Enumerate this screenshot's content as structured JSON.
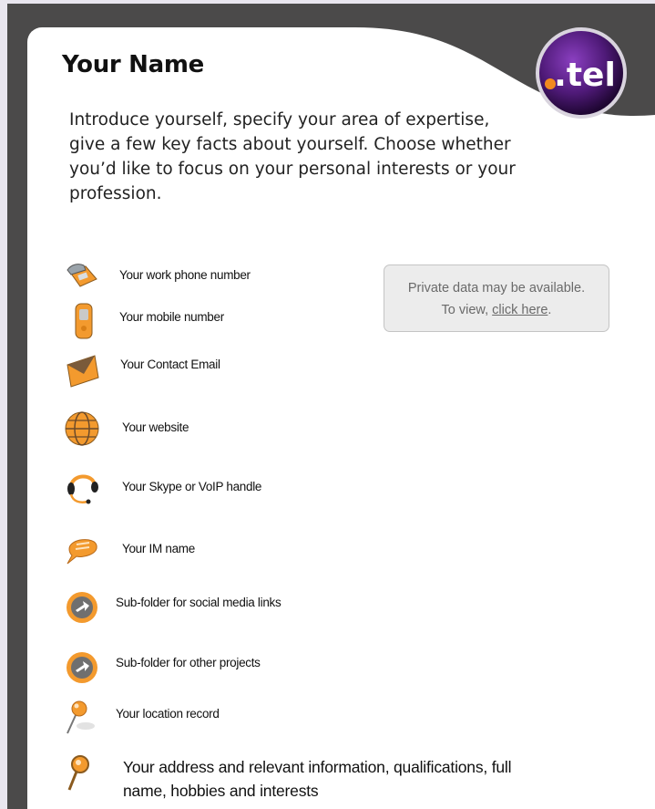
{
  "header": {
    "title": "Your Name",
    "logo_text": ".tel"
  },
  "intro": "Introduce yourself, specify your area of expertise, give a few key facts about yourself.  Choose whether you’d like to focus on your personal interests or your profession.",
  "private_notice": {
    "line1": "Private data may be available.",
    "line2_prefix": "To view, ",
    "link": "click here",
    "line2_suffix": "."
  },
  "records": [
    {
      "icon": "phone-icon",
      "label": "Your work phone number"
    },
    {
      "icon": "mobile-phone-icon",
      "label": "Your mobile number"
    },
    {
      "icon": "envelope-icon",
      "label": "Your Contact Email"
    },
    {
      "icon": "globe-icon",
      "label": "Your website"
    },
    {
      "icon": "headset-icon",
      "label": "Your Skype or VoIP handle"
    },
    {
      "icon": "chat-bubble-icon",
      "label": "Your IM name"
    },
    {
      "icon": "subfolder-arrow-icon",
      "label": "Sub-folder for social media links"
    },
    {
      "icon": "subfolder-arrow-icon",
      "label": "Sub-folder for other projects"
    },
    {
      "icon": "location-pin-icon",
      "label": "Your location record"
    },
    {
      "icon": "magnifier-icon",
      "label": "Your address and relevant information, qualifications, full name, hobbies and interests"
    }
  ],
  "colors": {
    "frame": "#4b4a4a",
    "accent_orange": "#f39a2e",
    "logo_purple": "#5b1f86"
  }
}
